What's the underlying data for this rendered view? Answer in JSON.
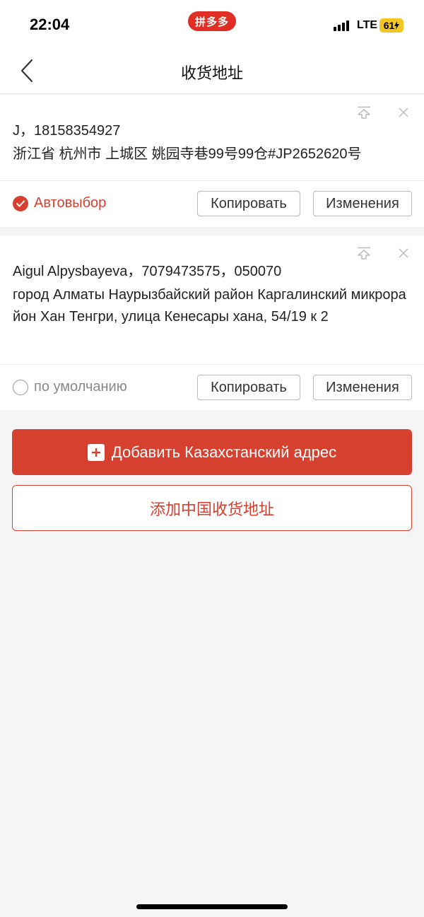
{
  "status_bar": {
    "time": "22:04",
    "app_badge": "拼多多",
    "network": "LTE",
    "battery": "61"
  },
  "header": {
    "title": "收货地址",
    "back_icon": "chevron-left-icon"
  },
  "addresses": [
    {
      "contact": "J，18158354927",
      "address": "浙江省 杭州市 上城区 姚园寺巷99号99仓#JP2652620号",
      "default_label": "Автовыбор",
      "is_default": true,
      "copy_label": "Копировать",
      "edit_label": "Изменения"
    },
    {
      "contact": "Aigul Alpysbayeva，7079473575，050070",
      "address": "город Алматы Наурызбайский район Каргалинский микрорайон Хан Тенгри, улица Кенесары хана, 54/19 к 2",
      "default_label": "по умолчанию",
      "is_default": false,
      "copy_label": "Копировать",
      "edit_label": "Изменения"
    }
  ],
  "buttons": {
    "add_kz": "Добавить Казахстанский адрес",
    "add_cn": "添加中国收货地址"
  },
  "colors": {
    "accent": "#d6402f",
    "brand": "#e02e24",
    "battery": "#f3c623"
  }
}
